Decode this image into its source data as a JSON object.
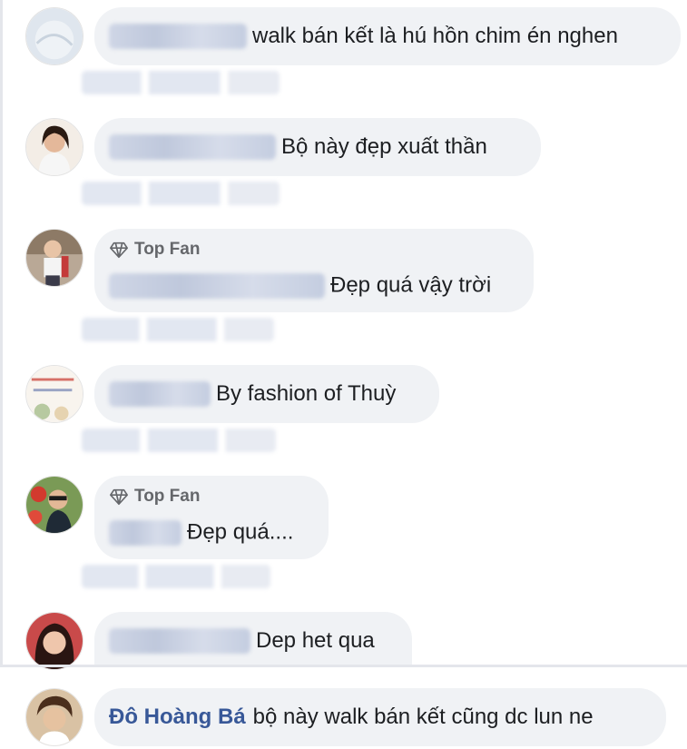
{
  "badge_label": "Top Fan",
  "colors": {
    "bubble": "#f0f2f5",
    "author": "#385898",
    "badge": "#65676b"
  },
  "comments": [
    {
      "text": "walk bán kết là hú hồn chim én nghen",
      "badge": false
    },
    {
      "text": "Bộ này đẹp xuất thần",
      "badge": false
    },
    {
      "text": "Đẹp quá vậy trời",
      "badge": true
    },
    {
      "text": "By fashion of Thuỳ",
      "badge": false
    },
    {
      "text": "Đẹp quá....",
      "badge": true
    },
    {
      "text": "Dep het qua",
      "badge": false
    }
  ],
  "reply": {
    "author": "Đô Hoàng Bá",
    "text": "bộ này walk bán kết cũng dc lun ne"
  }
}
